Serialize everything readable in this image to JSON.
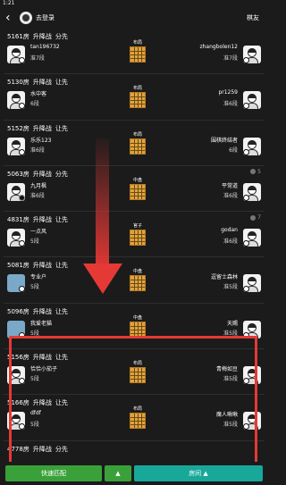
{
  "status": {
    "time": "1:21"
  },
  "header": {
    "back_icon": "back-arrow-icon",
    "login_label": "去登录",
    "friends_label": "棋友"
  },
  "rooms": [
    {
      "id": "5161房",
      "mode": "升降战",
      "rule": "分先",
      "count": "",
      "board_label": "布局",
      "left": {
        "name": "tan196732",
        "rank": "准7段",
        "stone": "white"
      },
      "right": {
        "name": "zhangbolen12",
        "rank": "准7段",
        "stone": "white"
      }
    },
    {
      "id": "5130房",
      "mode": "升降战",
      "rule": "让先",
      "count": "",
      "board_label": "布局",
      "left": {
        "name": "水中客",
        "rank": "6段",
        "stone": "white"
      },
      "right": {
        "name": "pr1259",
        "rank": "准6段",
        "stone": "white"
      }
    },
    {
      "id": "5152房",
      "mode": "升降战",
      "rule": "让先",
      "count": "",
      "board_label": "布局",
      "left": {
        "name": "乐乐123",
        "rank": "准6段",
        "stone": "white"
      },
      "right": {
        "name": "围棋终结者",
        "rank": "6段",
        "stone": "white"
      }
    },
    {
      "id": "5063房",
      "mode": "升降战",
      "rule": "分先",
      "count": "5",
      "board_label": "中盘",
      "left": {
        "name": "九月枫",
        "rank": "准6段",
        "stone": "black"
      },
      "right": {
        "name": "平常道",
        "rank": "准6段",
        "stone": "white"
      }
    },
    {
      "id": "4831房",
      "mode": "升降战",
      "rule": "让先",
      "count": "7",
      "board_label": "官子",
      "left": {
        "name": "一点风",
        "rank": "5段",
        "stone": "white"
      },
      "right": {
        "name": "godan",
        "rank": "准6段",
        "stone": "white"
      }
    },
    {
      "id": "5081房",
      "mode": "升降战",
      "rule": "让先",
      "count": "",
      "board_label": "中盘",
      "left": {
        "name": "专业户",
        "rank": "5段",
        "stone": "white",
        "photo": true
      },
      "right": {
        "name": "逗留士森林",
        "rank": "准5段",
        "stone": "white"
      }
    },
    {
      "id": "5096房",
      "mode": "升降战",
      "rule": "让先",
      "count": "",
      "board_label": "中盘",
      "left": {
        "name": "我爱老猫",
        "rank": "5段",
        "stone": "white",
        "photo": true
      },
      "right": {
        "name": "天赐",
        "rank": "准5段",
        "stone": "white"
      }
    },
    {
      "id": "5156房",
      "mode": "升降战",
      "rule": "让先",
      "count": "",
      "board_label": "布局",
      "left": {
        "name": "恰恰小茄子",
        "rank": "5段",
        "stone": "white"
      },
      "right": {
        "name": "青梅如豆",
        "rank": "准5段",
        "stone": "white"
      }
    },
    {
      "id": "5166房",
      "mode": "升降战",
      "rule": "让先",
      "count": "",
      "board_label": "布局",
      "left": {
        "name": "dfdf",
        "rank": "5段",
        "stone": "white"
      },
      "right": {
        "name": "魔人啾啾",
        "rank": "准5段",
        "stone": "white"
      }
    },
    {
      "id": "4778房",
      "mode": "升降战",
      "rule": "分先",
      "count": "",
      "board_label": "",
      "left": {
        "name": "",
        "rank": "",
        "stone": ""
      },
      "right": {
        "name": "",
        "rank": "",
        "stone": ""
      }
    }
  ],
  "bottom": {
    "quick_match_label": "快速匹配",
    "quick_match_arrow": "▲",
    "room_label": "房间 ▲"
  },
  "overlay": {
    "arrow_color": "#e53935",
    "highlight_color": "#e53935"
  },
  "colors": {
    "background": "#1b1b1b",
    "quick_match": "#3aa13a",
    "room_button": "#17a89a",
    "board": "#e0a43f"
  }
}
